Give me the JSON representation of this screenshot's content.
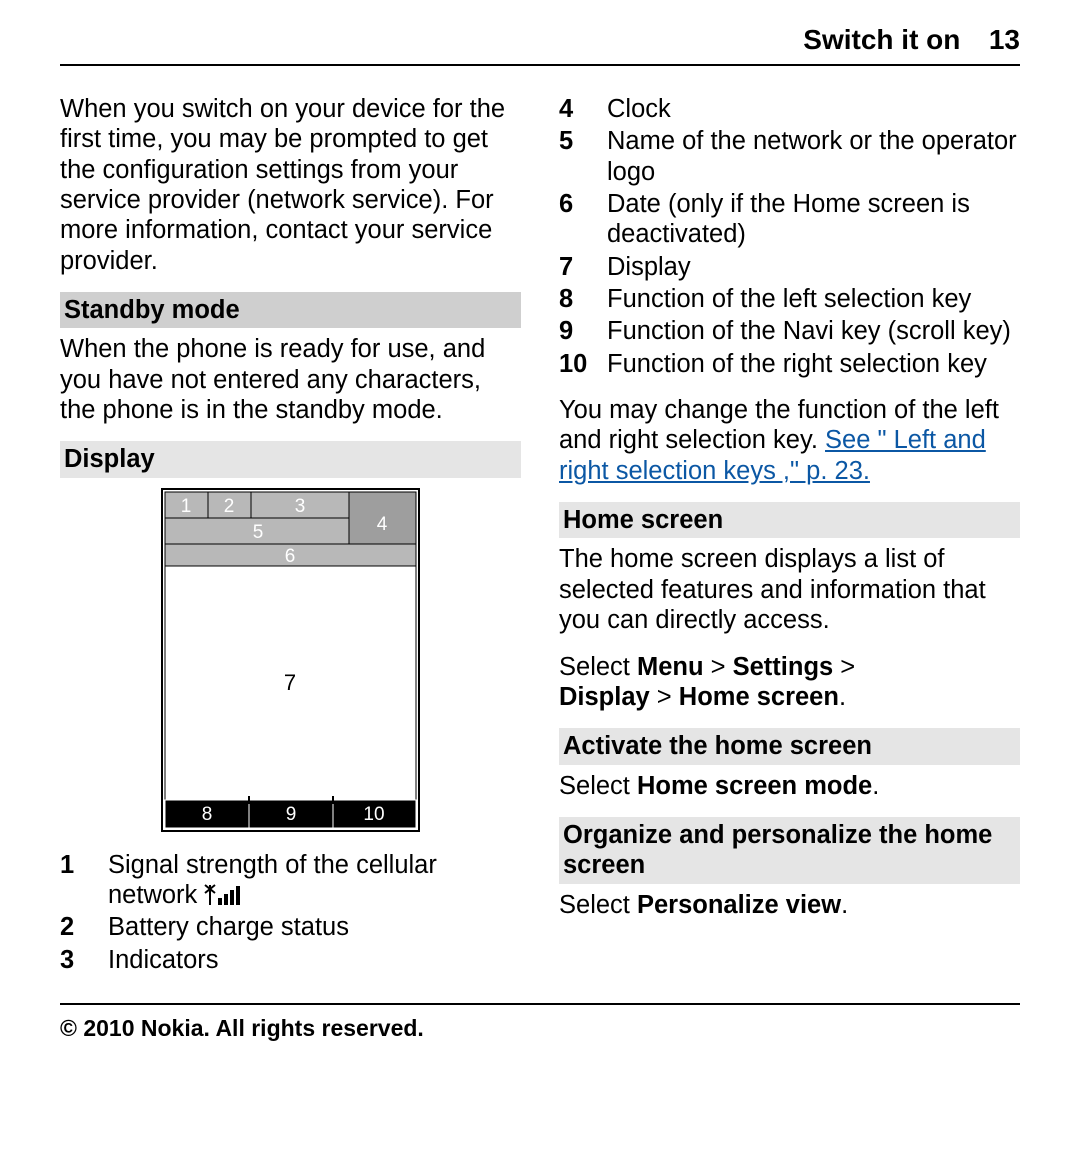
{
  "header": {
    "title": "Switch it on",
    "page_number": "13"
  },
  "left": {
    "intro": "When you switch on your device for the first time, you may be prompted to get the configuration settings from your service provider (network service). For more information, contact your service provider.",
    "standby_heading": "Standby mode",
    "standby_text": "When the phone is ready for use, and you have not entered any characters, the phone is in the standby mode.",
    "display_heading": "Display",
    "diagram_labels": {
      "1": "1",
      "2": "2",
      "3": "3",
      "4": "4",
      "5": "5",
      "6": "6",
      "7": "7",
      "8": "8",
      "9": "9",
      "10": "10"
    },
    "list": [
      {
        "n": "1",
        "text_a": "Signal strength of the cellular network ",
        "icon": "signal-icon"
      },
      {
        "n": "2",
        "text_a": "Battery charge status"
      },
      {
        "n": "3",
        "text_a": "Indicators"
      }
    ]
  },
  "right": {
    "list": [
      {
        "n": "4",
        "text": "Clock"
      },
      {
        "n": "5",
        "text": "Name of the network or the operator logo"
      },
      {
        "n": "6",
        "text": "Date (only if the Home screen is deactivated)"
      },
      {
        "n": "7",
        "text": "Display"
      },
      {
        "n": "8",
        "text": "Function of the left selection key"
      },
      {
        "n": "9",
        "text": "Function of the Navi key (scroll key)"
      },
      {
        "n": "10",
        "text": "Function of the right selection key"
      }
    ],
    "change_intro": "You may change the function of the left and right selection key. ",
    "link_text": "See \" Left and right selection keys ,\" p. 23.",
    "home_heading": "Home screen",
    "home_text": "The home screen displays a list of selected features and information that you can directly access.",
    "path_select": "Select ",
    "path_1": "Menu",
    "gt": " > ",
    "path_2": "Settings",
    "path_3": "Display",
    "path_4": "Home screen",
    "period": ".",
    "activate_heading": "Activate the home screen",
    "activate_select": "Select ",
    "activate_bold": "Home screen mode",
    "organize_heading": "Organize and personalize the home screen",
    "organize_select": "Select ",
    "organize_bold": "Personalize view"
  },
  "footer": "© 2010 Nokia. All rights reserved."
}
